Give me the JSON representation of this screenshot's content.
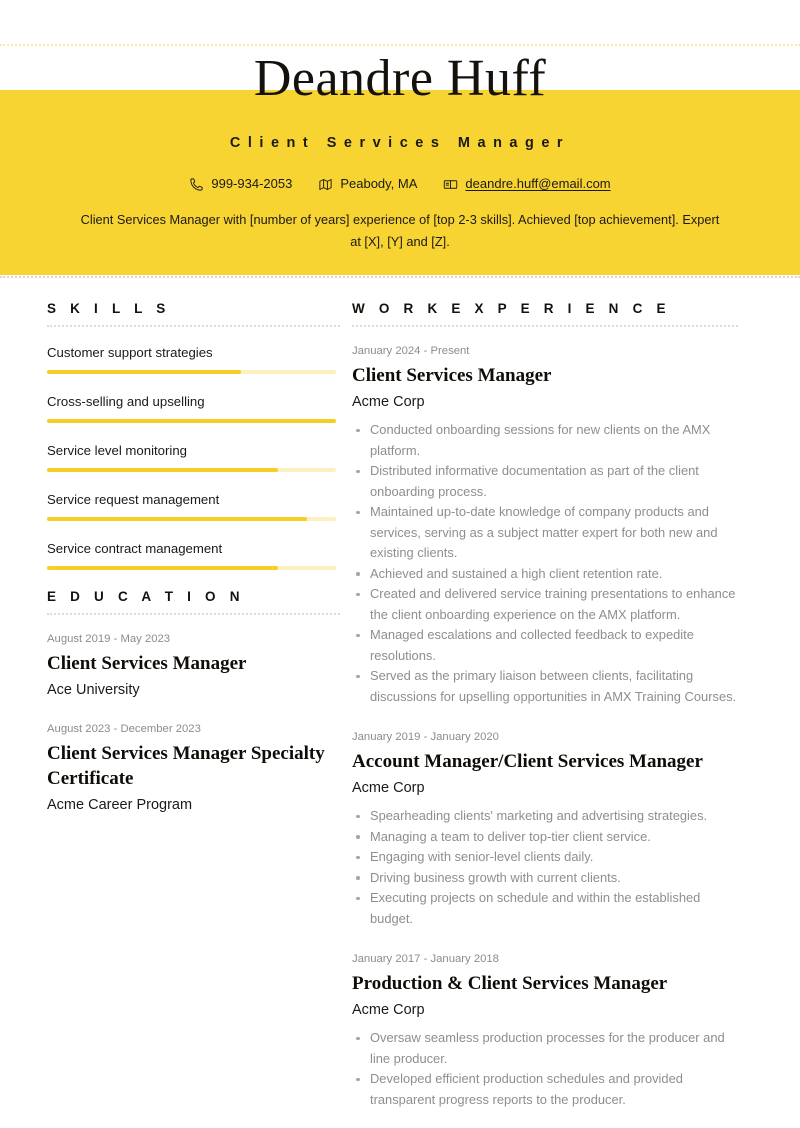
{
  "theme": {
    "banner_color": "#f8d433",
    "accent_bar_color": "#f5cf26",
    "accent_track_color": "#fdf0c0",
    "text_color": "#1c1a16",
    "muted_text_color": "#8e8e8e"
  },
  "header": {
    "name": "Deandre Huff",
    "job_title": "Client Services Manager",
    "contacts": [
      {
        "icon": "phone-icon",
        "value": "999-934-2053"
      },
      {
        "icon": "location-pin-icon",
        "value": "Peabody, MA"
      },
      {
        "icon": "mailbox-icon",
        "value": "deandre.huff@email.com"
      }
    ],
    "summary": "Client Services Manager with [number of years] experience of [top 2-3 skills]. Achieved [top achievement]. Expert at [X], [Y] and [Z]."
  },
  "skills": {
    "title": "S K I L L S",
    "items": [
      {
        "label": "Customer support strategies",
        "level": 67
      },
      {
        "label": "Cross-selling and upselling",
        "level": 100
      },
      {
        "label": "Service level monitoring",
        "level": 80
      },
      {
        "label": "Service request management",
        "level": 90
      },
      {
        "label": "Service contract management",
        "level": 80
      }
    ]
  },
  "education": {
    "title": "E D U C A T I O N",
    "items": [
      {
        "date": "August 2019 - May 2023",
        "degree": "Client Services Manager",
        "school": "Ace University"
      },
      {
        "date": "August 2023 - December 2023",
        "degree": "Client Services Manager Specialty Certificate",
        "school": "Acme Career Program"
      }
    ]
  },
  "work_experience": {
    "title": "W O R K   E X P E R I E N C E",
    "items": [
      {
        "date": "January 2024 - Present",
        "role": "Client Services Manager",
        "company": "Acme Corp",
        "bullets": [
          "Conducted onboarding sessions for new clients on the AMX platform.",
          "Distributed informative documentation as part of the client onboarding process.",
          "Maintained up-to-date knowledge of company products and services, serving as a subject matter expert for both new and existing clients.",
          "Achieved and sustained a high client retention rate.",
          "Created and delivered service training presentations to enhance the client onboarding experience on the AMX platform.",
          "Managed escalations and collected feedback to expedite resolutions.",
          "Served as the primary liaison between clients, facilitating discussions for upselling opportunities in AMX Training Courses."
        ]
      },
      {
        "date": "January 2019 - January 2020",
        "role": "Account Manager/Client Services Manager",
        "company": "Acme Corp",
        "bullets": [
          "Spearheading clients' marketing and advertising strategies.",
          "Managing a team to deliver top-tier client service.",
          "Engaging with senior-level clients daily.",
          "Driving business growth with current clients.",
          "Executing projects on schedule and within the established budget."
        ]
      },
      {
        "date": "January 2017 - January 2018",
        "role": "Production & Client Services Manager",
        "company": "Acme Corp",
        "bullets": [
          "Oversaw seamless production processes for the producer and line producer.",
          "Developed efficient production schedules and provided transparent progress reports to the producer."
        ]
      }
    ]
  }
}
